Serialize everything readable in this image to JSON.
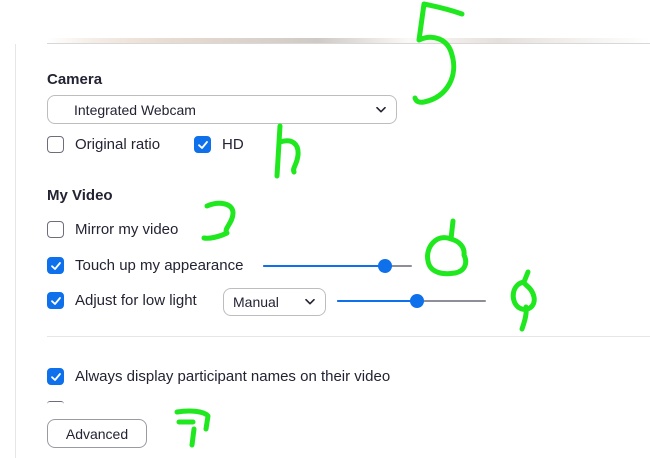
{
  "camera": {
    "title": "Camera",
    "selected": "Integrated Webcam",
    "options": [
      {
        "label": "Original ratio",
        "checked": false
      },
      {
        "label": "HD",
        "checked": true
      }
    ]
  },
  "my_video": {
    "title": "My Video",
    "mirror": {
      "label": "Mirror my video",
      "checked": false
    },
    "touch_up": {
      "label": "Touch up my appearance",
      "checked": true,
      "level": 0.82
    },
    "low_light": {
      "label": "Adjust for low light",
      "checked": true,
      "mode": "Manual",
      "level": 0.54
    }
  },
  "names": {
    "label": "Always display participant names on their video",
    "checked": true
  },
  "advanced_label": "Advanced",
  "colors": {
    "accent": "#0e71eb",
    "annotation": "#1fe81f"
  }
}
